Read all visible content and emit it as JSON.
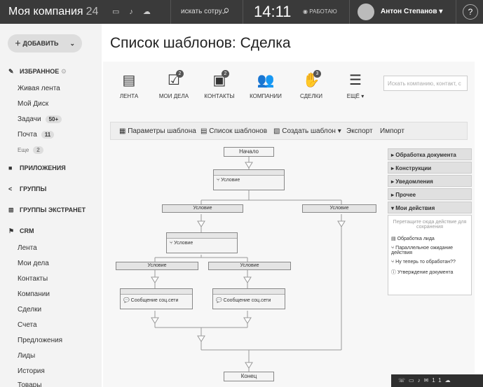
{
  "header": {
    "company": "Моя компания",
    "company_num": "24",
    "search": "искать сотру...",
    "time": "14:11",
    "status": "РАБОТАЮ",
    "user": "Антон Степанов",
    "help": "?"
  },
  "sidebar": {
    "add": "ДОБАВИТЬ",
    "favorites": "ИЗБРАННОЕ",
    "fav_items": [
      {
        "label": "Живая лента",
        "badge": ""
      },
      {
        "label": "Мой Диск",
        "badge": ""
      },
      {
        "label": "Задачи",
        "badge": "50+"
      },
      {
        "label": "Почта",
        "badge": "11"
      },
      {
        "label": "Еще",
        "badge": "2"
      }
    ],
    "apps": "ПРИЛОЖЕНИЯ",
    "groups": "ГРУППЫ",
    "extranet": "ГРУППЫ ЭКСТРАНЕТ",
    "crm": "CRM",
    "crm_items": [
      "Лента",
      "Мои дела",
      "Контакты",
      "Компании",
      "Сделки",
      "Счета",
      "Предложения",
      "Лиды",
      "История",
      "Товары"
    ]
  },
  "page": {
    "title": "Список шаблонов: Сделка"
  },
  "crm_bar": {
    "items": [
      {
        "label": "ЛЕНТА",
        "count": ""
      },
      {
        "label": "МОИ ДЕЛА",
        "count": "2"
      },
      {
        "label": "КОНТАКТЫ",
        "count": "2"
      },
      {
        "label": "КОМПАНИИ",
        "count": ""
      },
      {
        "label": "СДЕЛКИ",
        "count": "3"
      },
      {
        "label": "ЕЩЁ",
        "count": ""
      }
    ],
    "search_placeholder": "Искать компанию, контакт, с"
  },
  "toolbar": {
    "params": "Параметры шаблона",
    "list": "Список шаблонов",
    "create": "Создать шаблон",
    "export": "Экспорт",
    "import": "Импорт"
  },
  "diagram": {
    "start": "Начало",
    "condition_block": "Условие",
    "condition": "Условие",
    "social_msg": "Сообщение соц.сети",
    "end": "Конец"
  },
  "actions": {
    "groups": [
      "Обработка документа",
      "Конструкции",
      "Уведомления",
      "Прочее",
      "Мои действия"
    ],
    "drop_hint": "Перетащите сюда действие для сохранения",
    "my_items": [
      "Обработка лида",
      "Параллельное ожидание действия",
      "Ну теперь то обработан??",
      "Утверждение документа"
    ]
  },
  "footer": {
    "count": "11"
  }
}
